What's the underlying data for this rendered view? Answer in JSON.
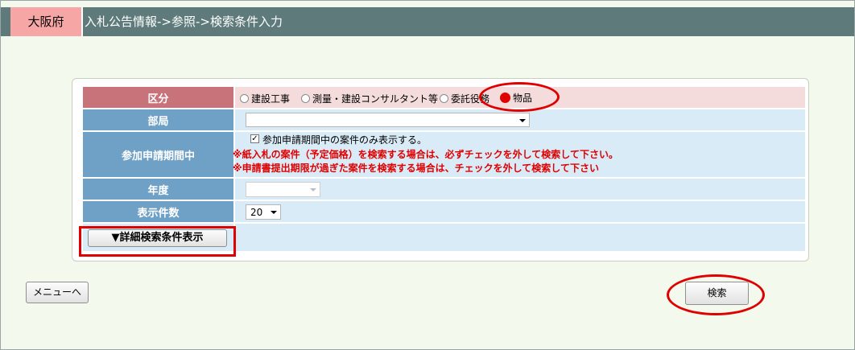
{
  "header": {
    "prefecture": "大阪府",
    "title": "入札公告情報->参照->検索条件入力"
  },
  "form": {
    "category": {
      "label": "区分",
      "options": [
        "建設工事",
        "測量・建設コンサルタント等",
        "委託役務",
        "物品"
      ],
      "selected": "物品"
    },
    "department": {
      "label": "部局",
      "value": ""
    },
    "application_period": {
      "label": "参加申請期間中",
      "checkbox_label": "参加申請期間中の案件のみ表示する。",
      "checked": true,
      "warning1": "※紙入札の案件（予定価格）を検索する場合は、必ずチェックを外して検索して下さい。",
      "warning2": "※申請書提出期限が過ぎた案件を検索する場合は、チェックを外して検索して下さい"
    },
    "fiscal_year": {
      "label": "年度",
      "value": ""
    },
    "display_count": {
      "label": "表示件数",
      "value": "20"
    },
    "detail_button": "▼詳細検索条件表示"
  },
  "actions": {
    "menu_button": "メニューへ",
    "search_button": "検索"
  },
  "colors": {
    "title_bar": "#5e7a7a",
    "prefecture_badge": "#f7a6a6",
    "label_cell": "#6fa0c6",
    "selected_label_cell": "#c8737a",
    "value_cell": "#d9ebf7",
    "highlight": "#e00000"
  }
}
